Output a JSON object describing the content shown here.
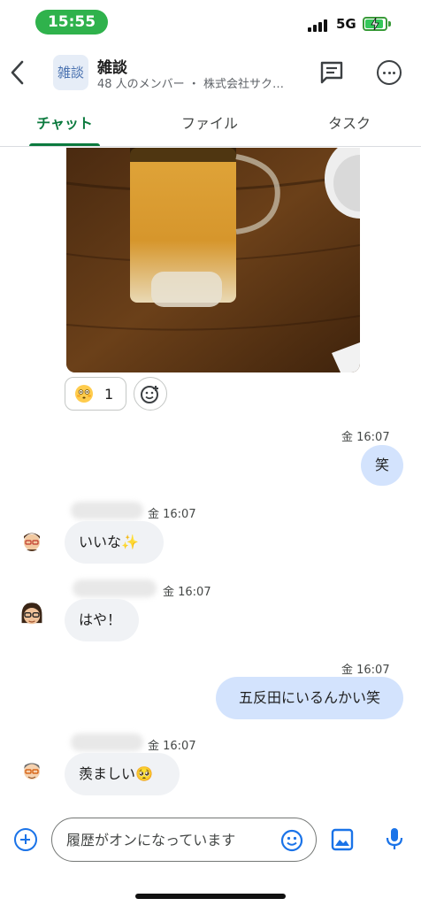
{
  "status_bar": {
    "time": "15:55",
    "network": "5G",
    "colors": {
      "time_pill": "#2fb24c",
      "battery": "#34c759"
    }
  },
  "header": {
    "back_icon": "chevron-left-icon",
    "space_avatar_text": "雑談",
    "title": "雑談",
    "subtitle": "48 人のメンバー ・ 株式会社サク…",
    "thread_icon": "threads-icon",
    "more_icon": "more-horizontal-icon"
  },
  "tabs": [
    {
      "label": "チャット",
      "active": true
    },
    {
      "label": "ファイル",
      "active": false
    },
    {
      "label": "タスク",
      "active": false
    }
  ],
  "accent_color": "#0b7a3e",
  "messages": {
    "photo": {
      "reaction": {
        "emoji": "flushed-face-emoji",
        "count": "1"
      },
      "add_reaction_icon": "add-reaction-icon"
    },
    "m1": {
      "time": "金 16:07",
      "text": "笑",
      "outgoing": true
    },
    "m2": {
      "time": "金 16:07",
      "text": "いいな✨",
      "outgoing": false
    },
    "m3": {
      "time": "金 16:07",
      "text": "はや！",
      "outgoing": false
    },
    "m4": {
      "time": "金 16:07",
      "text": "五反田にいるんかい笑",
      "outgoing": true
    },
    "m5": {
      "time": "金 16:07",
      "text": "羨ましい🥺",
      "outgoing": false
    }
  },
  "composer": {
    "placeholder": "履歴がオンになっています",
    "add_icon": "plus-circle-icon",
    "emoji_icon": "smiley-icon",
    "image_icon": "image-icon",
    "mic_icon": "mic-icon"
  }
}
